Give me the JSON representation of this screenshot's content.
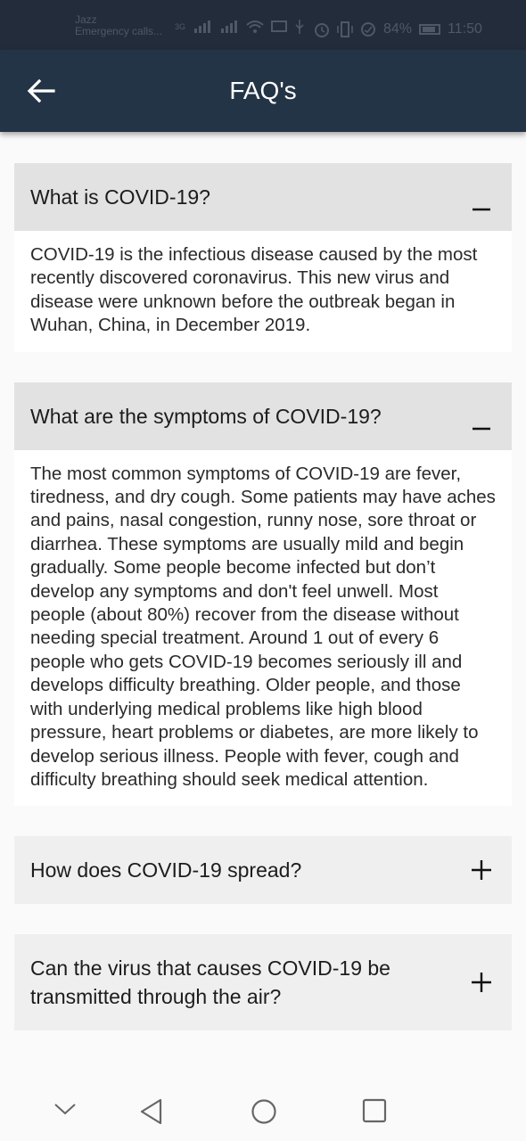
{
  "status_bar": {
    "carrier": "Jazz",
    "carrier_sub": "Emergency calls...",
    "network": "3G",
    "battery": "84%",
    "time": "11:50"
  },
  "app_bar": {
    "title": "FAQ's",
    "back_icon": "arrow-back-icon"
  },
  "faqs": [
    {
      "question": "What is COVID-19?",
      "expanded": true,
      "answer": "COVID-19 is the infectious disease caused by the most recently discovered coronavirus. This new virus and disease were unknown before the outbreak began in Wuhan, China, in December 2019."
    },
    {
      "question": "What are the symptoms of COVID-19?",
      "expanded": true,
      "answer": "The most common symptoms of COVID-19 are fever, tiredness, and dry cough. Some patients may have aches and pains, nasal congestion, runny nose, sore throat or diarrhea. These symptoms are usually mild and begin gradually. Some people become infected but don’t develop any symptoms and don't feel unwell. Most people (about 80%) recover from the disease without needing special treatment. Around 1 out of every 6 people who gets COVID-19 becomes seriously ill and develops difficulty breathing. Older people, and those with underlying medical problems like high blood pressure, heart problems or diabetes, are more likely to develop serious illness. People with fever, cough and difficulty breathing should seek medical attention."
    },
    {
      "question": "How does COVID-19 spread?",
      "expanded": false
    },
    {
      "question": "Can the virus that causes COVID-19 be transmitted through the air?",
      "expanded": false
    }
  ],
  "nav_bar": {
    "icons": [
      "chevron-down-icon",
      "back-triangle-icon",
      "home-circle-icon",
      "recents-square-icon"
    ]
  },
  "colors": {
    "app_bar": "#243447",
    "status_bar": "#232c3b",
    "header_expanded": "#e2e2e2",
    "header_collapsed": "#efefef"
  }
}
